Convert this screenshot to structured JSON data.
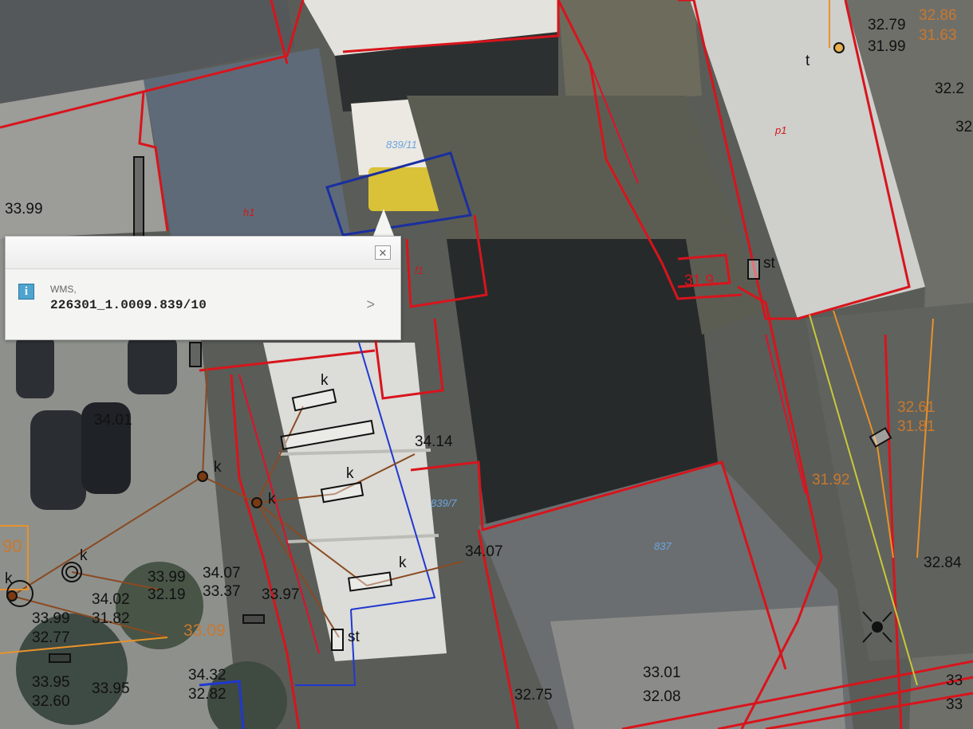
{
  "map": {
    "elevation_labels": [
      {
        "id": "e1",
        "text": "33.99"
      },
      {
        "id": "e2",
        "text": "34.01"
      },
      {
        "id": "e3",
        "text": "34.14"
      },
      {
        "id": "e4",
        "text": "34.07"
      },
      {
        "id": "e5",
        "text": "33.99"
      },
      {
        "id": "e6",
        "text": "32.19"
      },
      {
        "id": "e7",
        "text": "34.07"
      },
      {
        "id": "e8",
        "text": "33.37"
      },
      {
        "id": "e9",
        "text": "33.97"
      },
      {
        "id": "e10",
        "text": "34.02"
      },
      {
        "id": "e11",
        "text": "31.82"
      },
      {
        "id": "e12",
        "text": "33.99"
      },
      {
        "id": "e13",
        "text": "32.77"
      },
      {
        "id": "e14",
        "text": "33.95"
      },
      {
        "id": "e15",
        "text": "32.60"
      },
      {
        "id": "e16",
        "text": "33.95"
      },
      {
        "id": "e17",
        "text": "34.32"
      },
      {
        "id": "e18",
        "text": "32.82"
      },
      {
        "id": "e19",
        "text": "32.75"
      },
      {
        "id": "e20",
        "text": "33.01"
      },
      {
        "id": "e21",
        "text": "32.08"
      },
      {
        "id": "e22",
        "text": "32.79"
      },
      {
        "id": "e23",
        "text": "31.99"
      },
      {
        "id": "e24",
        "text": "32.84"
      }
    ],
    "orange_labels": [
      {
        "id": "o1",
        "text": "32.86"
      },
      {
        "id": "o2",
        "text": "31.63"
      },
      {
        "id": "o3",
        "text": "32.61"
      },
      {
        "id": "o4",
        "text": "31.81"
      },
      {
        "id": "o5",
        "text": "31.92"
      },
      {
        "id": "o6",
        "text": "33.09"
      },
      {
        "id": "o7",
        "text": "90"
      }
    ],
    "red_labels": [
      {
        "id": "r1",
        "text": "31.9"
      }
    ],
    "parcel_labels": [
      {
        "id": "p1",
        "text": "839/11"
      },
      {
        "id": "p2",
        "text": "839/7"
      },
      {
        "id": "p3",
        "text": "837"
      }
    ],
    "building_codes": [
      {
        "id": "b1",
        "text": "h1"
      },
      {
        "id": "b2",
        "text": "p1"
      },
      {
        "id": "b3",
        "text": "f1"
      }
    ],
    "point_letters": [
      {
        "id": "l1",
        "text": "k"
      },
      {
        "id": "l2",
        "text": "k"
      },
      {
        "id": "l3",
        "text": "k"
      },
      {
        "id": "l4",
        "text": "k"
      },
      {
        "id": "l5",
        "text": "k"
      },
      {
        "id": "l6",
        "text": "k"
      },
      {
        "id": "l7",
        "text": "st"
      },
      {
        "id": "l8",
        "text": "st"
      },
      {
        "id": "l9",
        "text": "t"
      },
      {
        "id": "l10",
        "text": "k"
      }
    ],
    "edge_labels": [
      {
        "id": "g1",
        "text": "32.2"
      },
      {
        "id": "g2",
        "text": "32"
      },
      {
        "id": "g3",
        "text": "33"
      },
      {
        "id": "g4",
        "text": "33"
      }
    ]
  },
  "popup": {
    "source_label": "WMS,",
    "feature_id": "226301_1.0009.839/10",
    "close_glyph": "✕",
    "next_glyph": ">",
    "info_glyph": "i"
  },
  "colors": {
    "parcel_boundary": "#d8141c",
    "selected_parcel": "#1a2fa0",
    "sewer_line": "#8a4a22",
    "gas_line": "#e8922a",
    "water_line": "#c9c93a",
    "elevation_text": "#111111"
  }
}
